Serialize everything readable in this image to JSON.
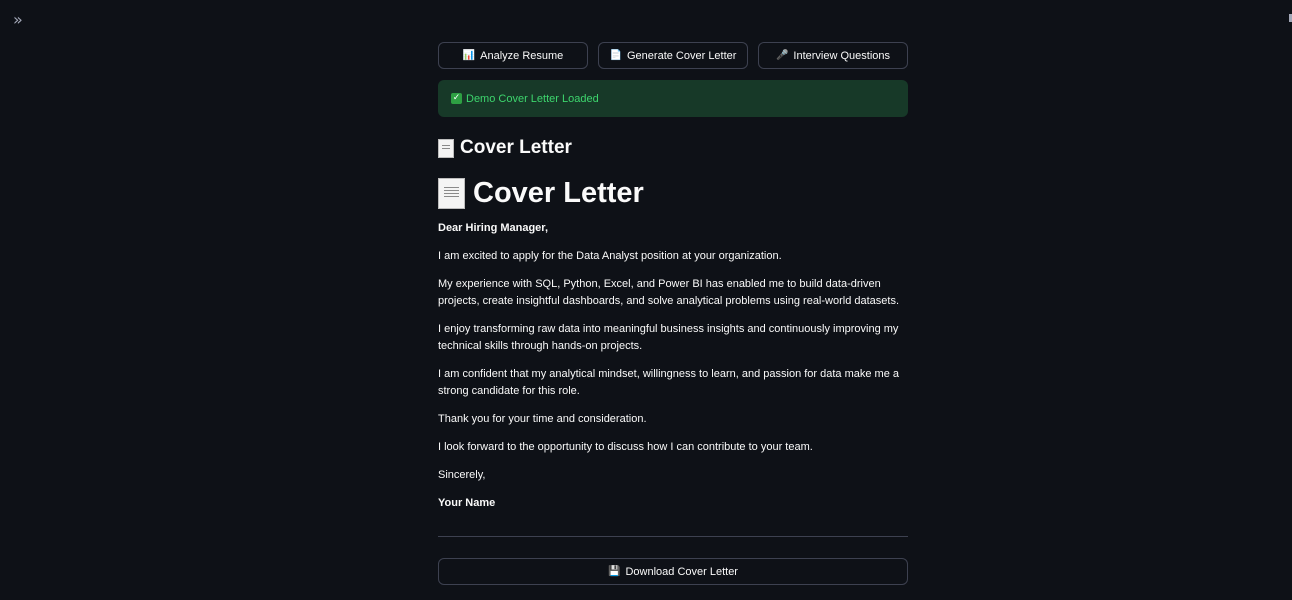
{
  "sidebar": {
    "toggle_icon": "»"
  },
  "toolbar": {
    "buttons": [
      {
        "icon": "📊",
        "label": "Analyze Resume"
      },
      {
        "icon": "📄",
        "label": "Generate Cover Letter"
      },
      {
        "icon": "🎤",
        "label": "Interview Questions"
      }
    ]
  },
  "alert": {
    "icon": "✓",
    "text": "Demo Cover Letter Loaded",
    "color": "#3dd56d"
  },
  "section_title": "Cover Letter",
  "letter": {
    "heading": "Cover Letter",
    "salutation": "Dear Hiring Manager,",
    "paragraphs": [
      "I am excited to apply for the Data Analyst position at your organization.",
      "My experience with SQL, Python, Excel, and Power BI has enabled me to build data-driven projects, create insightful dashboards, and solve analytical problems using real-world datasets.",
      "I enjoy transforming raw data into meaningful business insights and continuously improving my technical skills through hands-on projects.",
      "I am confident that my analytical mindset, willingness to learn, and passion for data make me a strong candidate for this role.",
      "Thank you for your time and consideration.",
      "I look forward to the opportunity to discuss how I can contribute to your team."
    ],
    "closing": "Sincerely,",
    "signature": "Your Name"
  },
  "download": {
    "icon": "💾",
    "label": "Download Cover Letter"
  },
  "colors": {
    "background": "#0e1117",
    "border": "#3d4150",
    "alert_bg": "#173928",
    "text": "#fafafa"
  }
}
